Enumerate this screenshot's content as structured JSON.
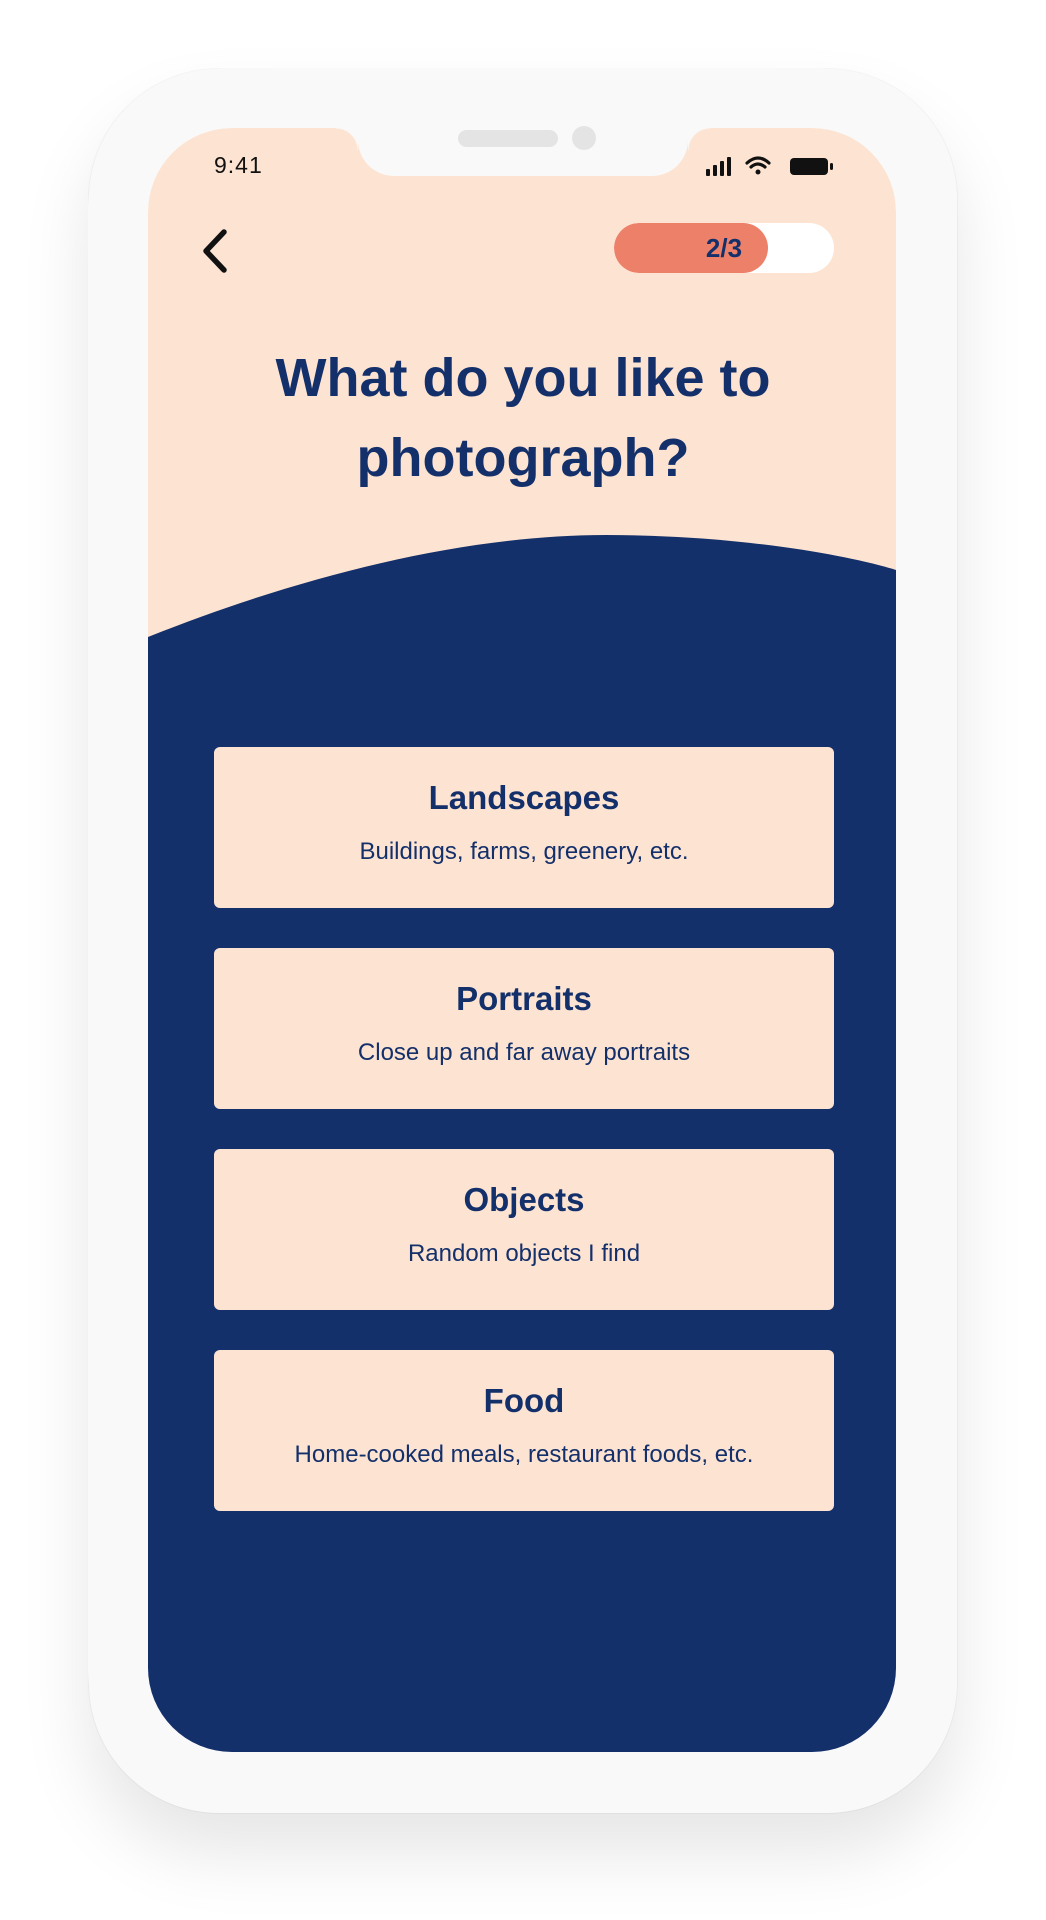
{
  "status_bar": {
    "time": "9:41"
  },
  "header": {
    "back_icon": "chevron-left-icon",
    "progress": {
      "label": "2/3",
      "fraction": 0.7
    }
  },
  "main": {
    "title": "What do you like to photograph?",
    "options": [
      {
        "title": "Landscapes",
        "subtitle": "Buildings, farms, greenery, etc."
      },
      {
        "title": "Portraits",
        "subtitle": "Close up and far away portraits"
      },
      {
        "title": "Objects",
        "subtitle": "Random objects I find"
      },
      {
        "title": "Food",
        "subtitle": "Home-cooked meals, restaurant foods, etc."
      }
    ]
  },
  "colors": {
    "background_peach": "#fde4d2",
    "navy": "#14306b",
    "accent_coral": "#ec8068",
    "progress_track": "#ffffff"
  }
}
